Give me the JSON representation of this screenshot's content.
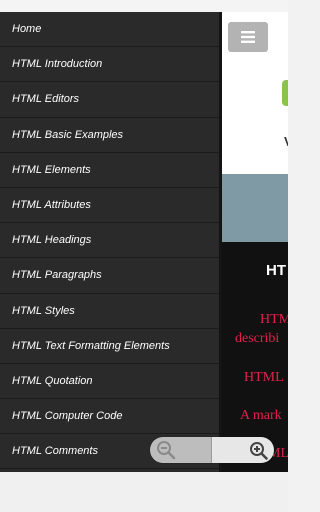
{
  "drawer": {
    "items": [
      {
        "label": "Home"
      },
      {
        "label": "HTML Introduction"
      },
      {
        "label": "HTML Editors"
      },
      {
        "label": "HTML Basic Examples"
      },
      {
        "label": "HTML Elements"
      },
      {
        "label": "HTML Attributes"
      },
      {
        "label": "HTML Headings"
      },
      {
        "label": "HTML Paragraphs"
      },
      {
        "label": "HTML Styles"
      },
      {
        "label": "HTML Text Formatting Elements"
      },
      {
        "label": "HTML Quotation"
      },
      {
        "label": "HTML Computer Code"
      },
      {
        "label": "HTML Comments"
      }
    ]
  },
  "content": {
    "header_letter": "V",
    "section_title": "HT",
    "lines": [
      "HTM",
      "describi",
      "HTML",
      "A mark",
      "ML"
    ]
  },
  "icons": {
    "menu_button": "hamburger-icon",
    "zoom_out": "zoom-out-icon",
    "zoom_in": "zoom-in-icon"
  },
  "colors": {
    "drawer_bg": "#2a2a2a",
    "link_red": "#e0224b",
    "logo_green": "#8bc34a"
  }
}
